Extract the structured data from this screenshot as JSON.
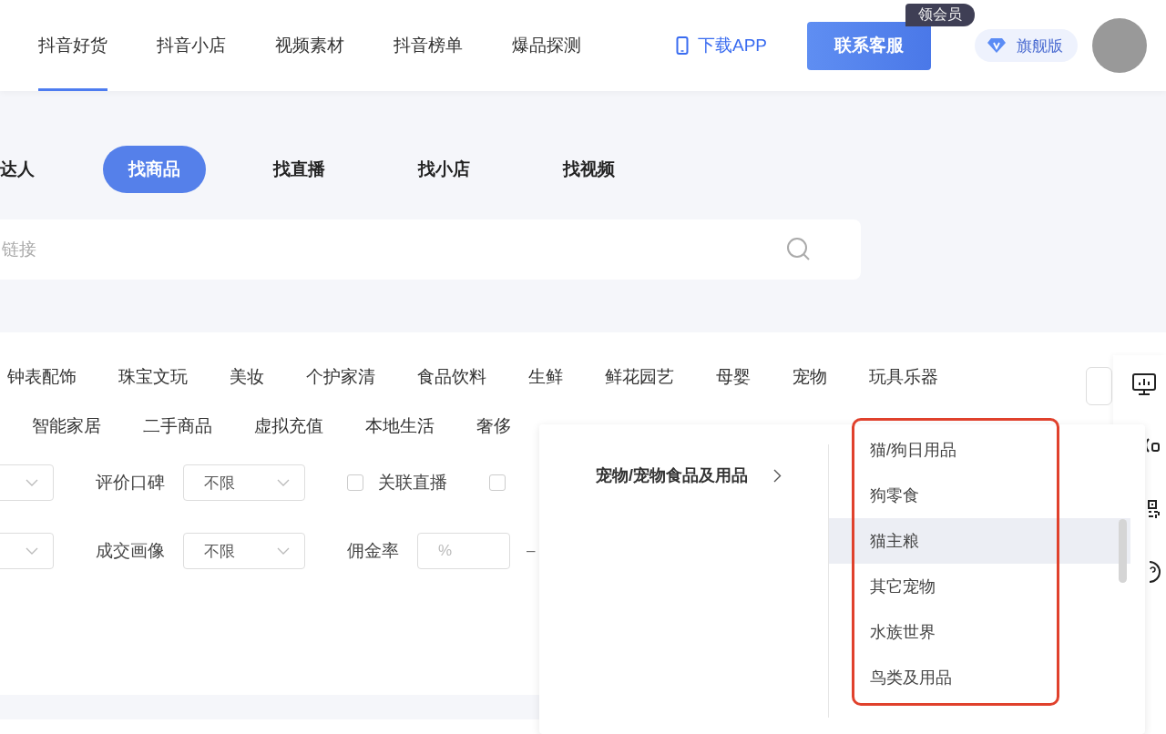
{
  "header": {
    "nav": [
      {
        "label": "抖音好货",
        "selected": true
      },
      {
        "label": "抖音小店",
        "selected": false
      },
      {
        "label": "视频素材",
        "selected": false
      },
      {
        "label": "抖音榜单",
        "selected": false
      },
      {
        "label": "爆品探测",
        "selected": false
      }
    ],
    "download": "下载APP",
    "contact": "联系客服",
    "badge": "领会员",
    "vip": "旗舰版"
  },
  "search": {
    "tabs": [
      {
        "label": "达人",
        "selected": false
      },
      {
        "label": "找商品",
        "selected": true
      },
      {
        "label": "找直播",
        "selected": false
      },
      {
        "label": "找小店",
        "selected": false
      },
      {
        "label": "找视频",
        "selected": false
      }
    ],
    "placeholder": "链接"
  },
  "categories": [
    [
      "钟表配饰",
      "珠宝文玩",
      "美妆",
      "个护家清",
      "食品饮料",
      "生鲜",
      "鲜花园艺",
      "母婴",
      "宠物",
      "玩具乐器"
    ],
    [
      "智能家居",
      "二手商品",
      "虚拟充值",
      "本地生活",
      "奢侈"
    ]
  ],
  "filters": [
    [
      {
        "kind": "select"
      },
      {
        "kind": "label",
        "text": "评价口碑"
      },
      {
        "kind": "select",
        "value": "不限"
      },
      {
        "kind": "checkbox",
        "label": "关联直播",
        "checked": false
      },
      {
        "kind": "checkbox",
        "checked": false
      }
    ],
    [
      {
        "kind": "select"
      },
      {
        "kind": "label",
        "text": "成交画像"
      },
      {
        "kind": "select",
        "value": "不限"
      },
      {
        "kind": "label",
        "text": "佣金率"
      },
      {
        "kind": "input",
        "placeholder": "%"
      },
      {
        "kind": "text",
        "text": "–"
      }
    ]
  ],
  "popup": {
    "category": "宠物/宠物食品及用品",
    "items": [
      {
        "label": "猫/狗日用品",
        "hovered": false
      },
      {
        "label": "狗零食",
        "hovered": false
      },
      {
        "label": "猫主粮",
        "hovered": true
      },
      {
        "label": "其它宠物",
        "hovered": false
      },
      {
        "label": "水族世界",
        "hovered": false
      },
      {
        "label": "鸟类及用品",
        "hovered": false
      }
    ]
  }
}
